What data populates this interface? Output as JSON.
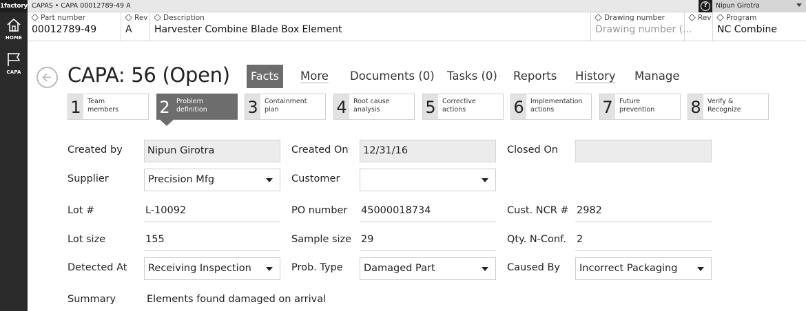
{
  "app": {
    "brand": "1factory",
    "breadcrumb": "CAPAS • CAPA 00012789-49 A",
    "user": "Nipun Girotra"
  },
  "sidenav": [
    {
      "label": "HOME",
      "icon": "home-icon"
    },
    {
      "label": "CAPA",
      "icon": "flag-icon"
    }
  ],
  "infobar": {
    "part_number": {
      "label": "Part number",
      "value": "00012789-49"
    },
    "rev": {
      "label": "Rev",
      "value": "A"
    },
    "description": {
      "label": "Description",
      "value": "Harvester Combine Blade Box Element"
    },
    "drawing_number": {
      "label": "Drawing number",
      "placeholder": "Drawing number (..."
    },
    "drawing_rev": {
      "label": "Rev",
      "value": ""
    },
    "program": {
      "label": "Program",
      "value": "NC Combine"
    }
  },
  "title": "CAPA: 56 (Open)",
  "tabs": [
    {
      "label": "Facts",
      "active": true
    },
    {
      "label": "More"
    },
    {
      "label": "Documents (0)"
    },
    {
      "label": "Tasks (0)"
    },
    {
      "label": "Reports"
    },
    {
      "label": "History"
    },
    {
      "label": "Manage"
    }
  ],
  "steps": [
    {
      "num": "1",
      "line1": "Team",
      "line2": "members"
    },
    {
      "num": "2",
      "line1": "Problem",
      "line2": "definition",
      "active": true
    },
    {
      "num": "3",
      "line1": "Containment",
      "line2": "plan"
    },
    {
      "num": "4",
      "line1": "Root cause",
      "line2": "analysis"
    },
    {
      "num": "5",
      "line1": "Corrective",
      "line2": "actions"
    },
    {
      "num": "6",
      "line1": "Implementation",
      "line2": "actions"
    },
    {
      "num": "7",
      "line1": "Future",
      "line2": "prevention"
    },
    {
      "num": "8",
      "line1": "Verify &",
      "line2": "Recognize"
    }
  ],
  "form": {
    "created_by": {
      "label": "Created by",
      "value": "Nipun Girotra"
    },
    "created_on": {
      "label": "Created On",
      "value": "12/31/16"
    },
    "closed_on": {
      "label": "Closed On",
      "value": ""
    },
    "supplier": {
      "label": "Supplier",
      "value": "Precision Mfg"
    },
    "customer": {
      "label": "Customer",
      "value": ""
    },
    "lot": {
      "label": "Lot #",
      "value": "L-10092"
    },
    "po_number": {
      "label": "PO number",
      "value": "45000018734"
    },
    "cust_ncr": {
      "label": "Cust. NCR #",
      "value": "2982"
    },
    "lot_size": {
      "label": "Lot size",
      "value": "155"
    },
    "sample_size": {
      "label": "Sample size",
      "value": "29"
    },
    "qty_nconf": {
      "label": "Qty. N-Conf.",
      "value": "2"
    },
    "detected_at": {
      "label": "Detected At",
      "value": "Receiving Inspection"
    },
    "prob_type": {
      "label": "Prob. Type",
      "value": "Damaged Part"
    },
    "caused_by": {
      "label": "Caused By",
      "value": "Incorrect Packaging"
    },
    "summary": {
      "label": "Summary",
      "value": "Elements found damaged on arrival"
    }
  }
}
